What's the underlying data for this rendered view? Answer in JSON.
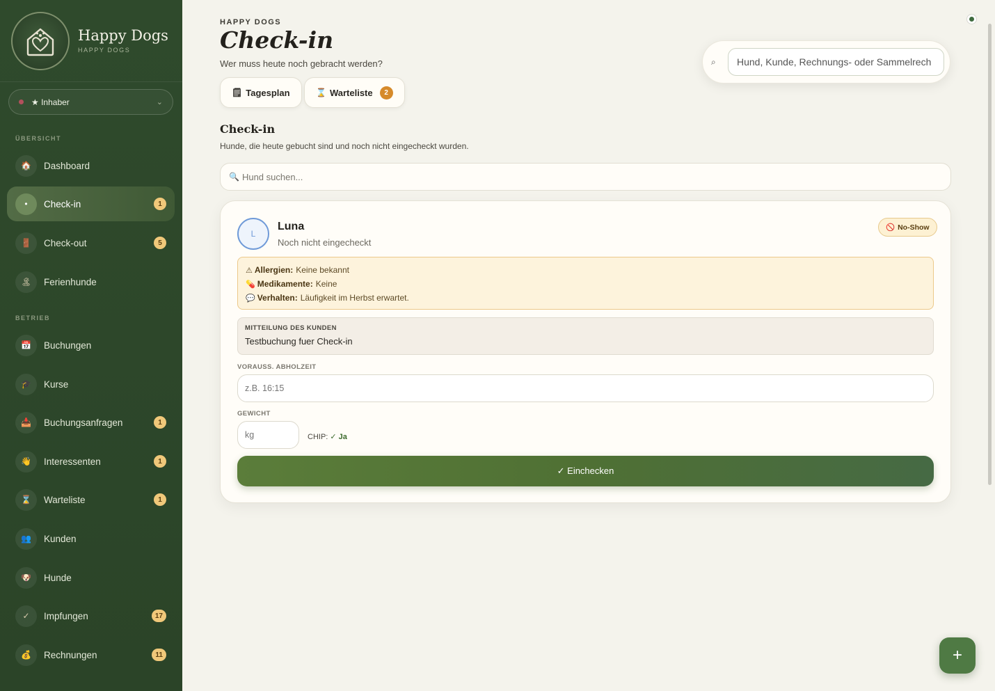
{
  "brand": {
    "title": "Happy Dogs",
    "subtitle": "HAPPY DOGS"
  },
  "role": {
    "label": "★ Inhaber"
  },
  "sidebar": {
    "sections": [
      {
        "label": "ÜBERSICHT"
      },
      {
        "label": "BETRIEB"
      }
    ],
    "items": [
      {
        "label": "Dashboard",
        "icon": "house-icon",
        "glyph": "🏠"
      },
      {
        "label": "Check-in",
        "icon": "dot-icon",
        "glyph": "•",
        "badge": "1",
        "active": true
      },
      {
        "label": "Check-out",
        "icon": "door-icon",
        "glyph": "🚪",
        "badge": "5"
      },
      {
        "label": "Ferienhunde",
        "icon": "island-icon",
        "glyph": "🏝"
      },
      {
        "label": "Buchungen",
        "icon": "calendar-icon",
        "glyph": "📅"
      },
      {
        "label": "Kurse",
        "icon": "graduation-cap-icon",
        "glyph": "🎓"
      },
      {
        "label": "Buchungsanfragen",
        "icon": "inbox-icon",
        "glyph": "📥",
        "badge": "1"
      },
      {
        "label": "Interessenten",
        "icon": "wave-hand-icon",
        "glyph": "👋",
        "badge": "1"
      },
      {
        "label": "Warteliste",
        "icon": "hourglass-icon",
        "glyph": "⌛",
        "badge": "1"
      },
      {
        "label": "Kunden",
        "icon": "people-icon",
        "glyph": "👥"
      },
      {
        "label": "Hunde",
        "icon": "dog-icon",
        "glyph": "🐶"
      },
      {
        "label": "Impfungen",
        "icon": "check-icon",
        "glyph": "✓",
        "badge": "17"
      },
      {
        "label": "Rechnungen",
        "icon": "money-bag-icon",
        "glyph": "💰",
        "badge": "11"
      }
    ]
  },
  "header": {
    "eyebrow": "HAPPY DOGS",
    "title": "Check-in",
    "subtitle": "Wer muss heute noch gebracht werden?",
    "tagesplan_label": "Tagesplan",
    "warteliste_label": "Warteliste",
    "warteliste_count": "2",
    "global_search_value": "Hund, Kunde, Rechnungs- oder Sammelrech"
  },
  "section": {
    "title": "Check-in",
    "description": "Hunde, die heute gebucht sind und noch nicht eingecheckt wurden.",
    "search_placeholder": "Hund suchen..."
  },
  "card": {
    "avatar_initial": "L",
    "dog_name": "Luna",
    "dog_status": "Noch nicht eingecheckt",
    "noshow_label": "No-Show",
    "allergies_label": "Allergien:",
    "allergies_value": "Keine bekannt",
    "medication_label": "Medikamente:",
    "medication_value": "Keine",
    "behavior_label": "Verhalten:",
    "behavior_value": "Läufigkeit im Herbst erwartet.",
    "message_label": "MITTEILUNG DES KUNDEN",
    "message_text": "Testbuchung fuer Check-in",
    "pickup_label": "VORAUSS. ABHOLZEIT",
    "pickup_placeholder": "z.B. 16:15",
    "weight_label": "GEWICHT",
    "weight_placeholder": "kg",
    "chip_label": "CHIP:",
    "chip_value": "✓ Ja",
    "checkin_button": "✓ Einchecken"
  },
  "fab": {
    "label": "+"
  },
  "colors": {
    "sidebar": "#2f4a2c",
    "accent": "#5b7d3a",
    "badge": "#f0c87a",
    "alert": "#fdf3dc"
  }
}
